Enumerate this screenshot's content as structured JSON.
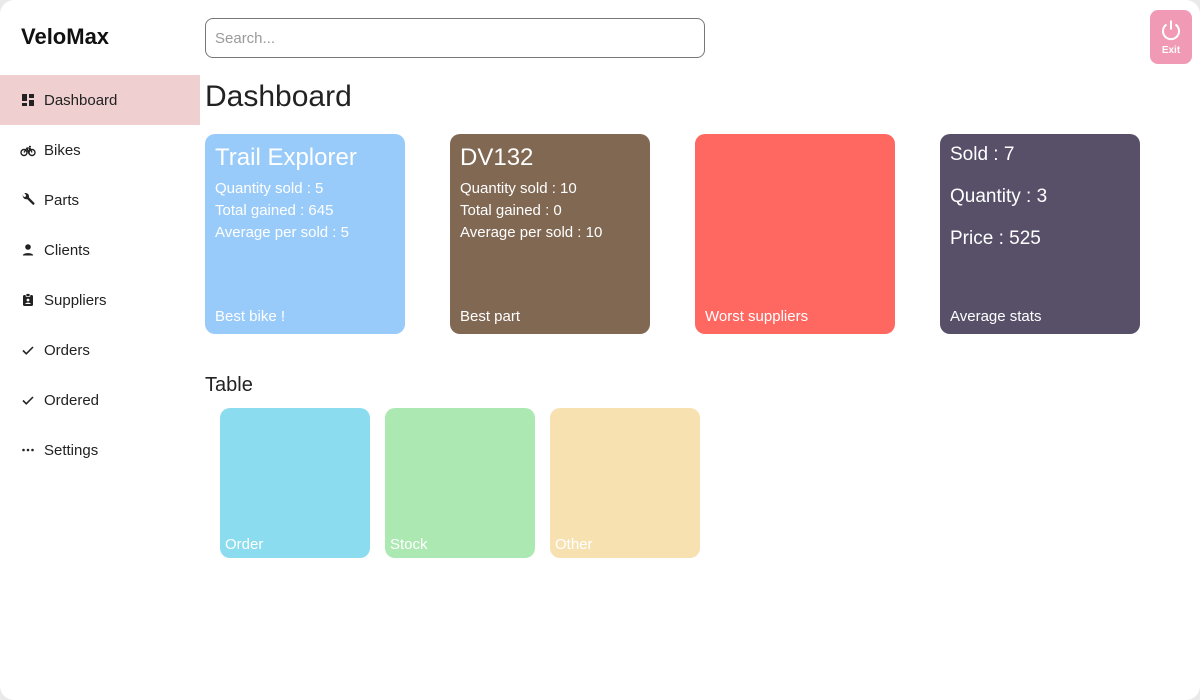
{
  "app": {
    "brand": "VeloMax"
  },
  "search": {
    "placeholder": "Search..."
  },
  "exit": {
    "label": "Exit"
  },
  "sidebar": {
    "items": [
      {
        "label": "Dashboard",
        "icon": "dashboard-icon"
      },
      {
        "label": "Bikes",
        "icon": "bike-icon"
      },
      {
        "label": "Parts",
        "icon": "wrench-icon"
      },
      {
        "label": "Clients",
        "icon": "person-icon"
      },
      {
        "label": "Suppliers",
        "icon": "badge-icon"
      },
      {
        "label": "Orders",
        "icon": "check-icon"
      },
      {
        "label": "Ordered",
        "icon": "check-icon"
      },
      {
        "label": "Settings",
        "icon": "more-icon"
      }
    ],
    "active": "Dashboard"
  },
  "main": {
    "title": "Dashboard",
    "cards": [
      {
        "title": "Trail Explorer",
        "lines": [
          "Quantity sold : 5",
          "Total gained : 645",
          "Average per sold : 5"
        ],
        "footer": "Best bike !",
        "color": "#98cbf9"
      },
      {
        "title": "DV132",
        "lines": [
          "Quantity sold : 10",
          "Total gained : 0",
          "Average per sold : 10"
        ],
        "footer": "Best part",
        "color": "#816853"
      },
      {
        "footer": "Worst suppliers",
        "color": "#ff6761"
      },
      {
        "stats": [
          "Sold : 7",
          "Quantity : 3",
          "Price : 525"
        ],
        "footer": "Average stats",
        "color": "#585069"
      }
    ],
    "table_section": {
      "title": "Table",
      "tiles": [
        {
          "label": "Order",
          "color": "#8bdcee"
        },
        {
          "label": "Stock",
          "color": "#ace9b2"
        },
        {
          "label": "Other",
          "color": "#f8e1b0"
        }
      ]
    }
  },
  "colors": {
    "active_nav": "#efcfd0",
    "exit_button": "#f19ab5"
  }
}
